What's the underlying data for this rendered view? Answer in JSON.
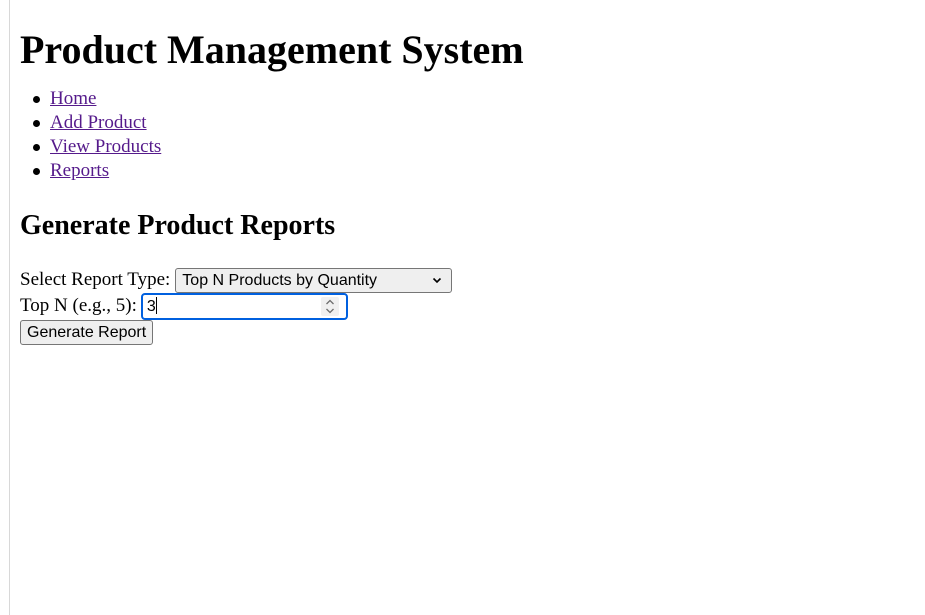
{
  "page": {
    "title": "Product Management System"
  },
  "nav": {
    "items": [
      {
        "label": "Home"
      },
      {
        "label": "Add Product"
      },
      {
        "label": "View Products"
      },
      {
        "label": "Reports"
      }
    ]
  },
  "reports": {
    "heading": "Generate Product Reports",
    "report_type_label": "Select Report Type:",
    "report_type_selected": "Top N Products by Quantity",
    "top_n_label": "Top N (e.g., 5):",
    "top_n_value": "3",
    "generate_button": "Generate Report"
  },
  "icons": {
    "select_arrow": "chevron-down-icon",
    "spinner": "spin-updown-icon"
  },
  "colors": {
    "link_visited": "#551a8b",
    "focus_border": "#0060df"
  }
}
